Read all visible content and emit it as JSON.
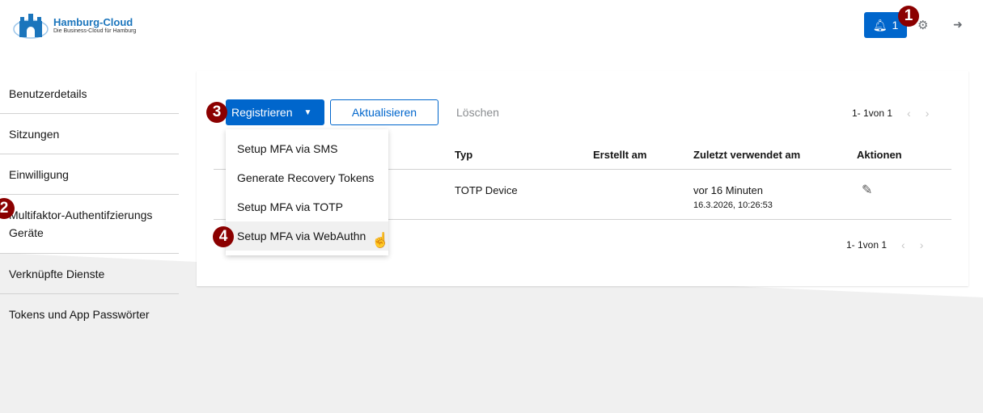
{
  "header": {
    "logo_title": "Hamburg-Cloud",
    "logo_subtitle": "Die Business-Cloud für Hamburg",
    "notifications_count": "1",
    "accent": "#0066cc"
  },
  "markers": [
    "1",
    "2",
    "3",
    "4"
  ],
  "sidebar": {
    "items": [
      {
        "label": "Benutzerdetails"
      },
      {
        "label": "Sitzungen"
      },
      {
        "label": "Einwilligung"
      },
      {
        "label": "Multifaktor-Authentifzierungs Geräte"
      },
      {
        "label": "Verknüpfte Dienste"
      },
      {
        "label": "Tokens und App Passwörter"
      }
    ]
  },
  "toolbar": {
    "register_label": "Registrieren",
    "refresh_label": "Aktualisieren",
    "delete_label": "Löschen",
    "pagination": "1- 1von 1"
  },
  "menu": {
    "items": [
      {
        "label": "Setup MFA via SMS"
      },
      {
        "label": "Generate Recovery Tokens"
      },
      {
        "label": "Setup MFA via TOTP"
      },
      {
        "label": "Setup MFA via WebAuthn"
      }
    ]
  },
  "table": {
    "columns": [
      "Typ",
      "Erstellt am",
      "Zuletzt verwendet am",
      "Aktionen"
    ],
    "rows": [
      {
        "type": "TOTP Device",
        "created": "",
        "last_used": "vor 16 Minuten",
        "last_used_date": "16.3.2026, 10:26:53"
      }
    ]
  },
  "footer_pagination": "1- 1von 1"
}
